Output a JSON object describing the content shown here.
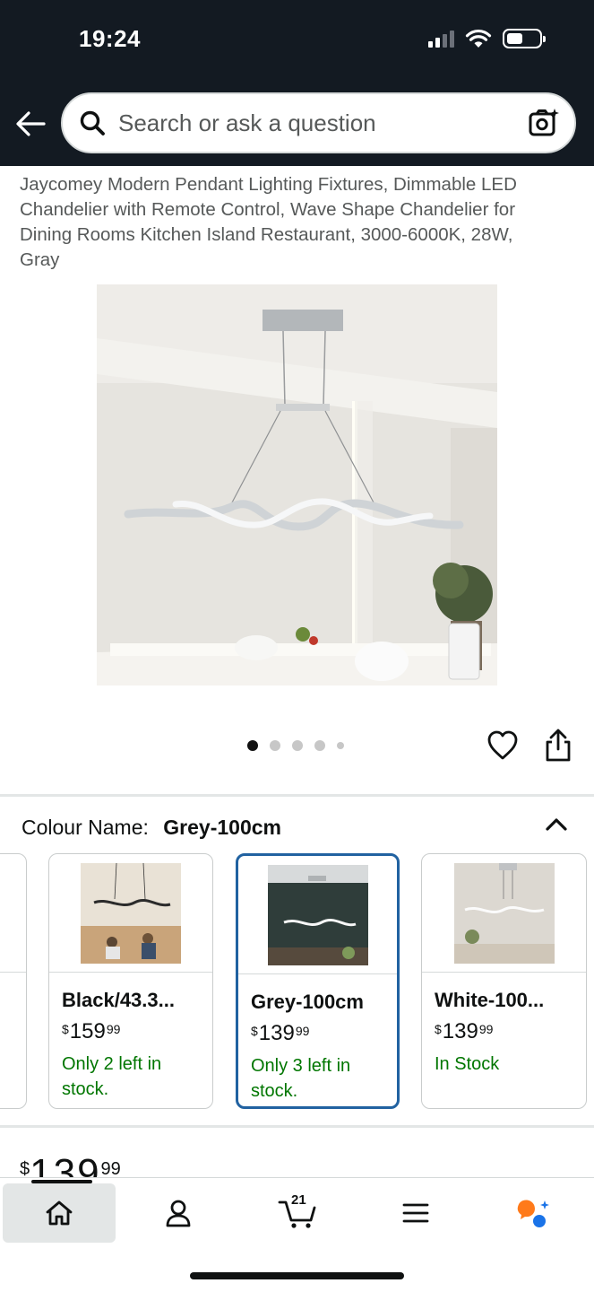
{
  "status_bar": {
    "time": "19:24"
  },
  "search": {
    "placeholder": "Search or ask a question"
  },
  "product": {
    "title": "Jaycomey Modern Pendant Lighting Fixtures, Dimmable LED Chandelier with Remote Control, Wave Shape Chandelier for Dining Rooms Kitchen Island Restaurant, 3000-6000K, 28W, Gray",
    "image_count": 5,
    "active_image_index": 0
  },
  "variations": {
    "label": "Colour Name:",
    "selected_value": "Grey-100cm",
    "options": [
      {
        "name": "Black/43.3...",
        "currency": "$",
        "price_whole": "159",
        "price_cents": "99",
        "stock": "Only 2 left in stock.",
        "selected": false
      },
      {
        "name": "Grey-100cm",
        "currency": "$",
        "price_whole": "139",
        "price_cents": "99",
        "stock": "Only 3 left in stock.",
        "selected": true
      },
      {
        "name": "White-100...",
        "currency": "$",
        "price_whole": "139",
        "price_cents": "99",
        "stock": "In Stock",
        "selected": false
      }
    ]
  },
  "price": {
    "currency": "$",
    "whole": "139",
    "cents": "99"
  },
  "bottom_nav": {
    "cart_count": "21",
    "active": "home"
  },
  "colors": {
    "header_bg": "#131a22",
    "stock_green": "#007600",
    "selected_border": "#2162a1",
    "assistant_orange": "#ff7a1a",
    "assistant_blue": "#1a73e8"
  }
}
